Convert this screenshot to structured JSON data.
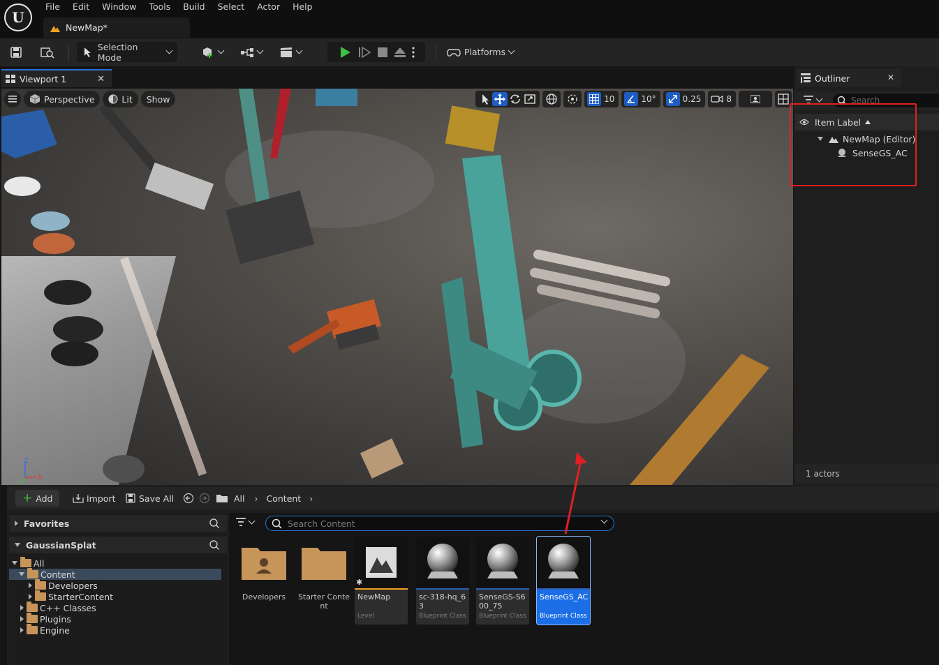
{
  "menu": [
    "File",
    "Edit",
    "Window",
    "Tools",
    "Build",
    "Select",
    "Actor",
    "Help"
  ],
  "document_tab": {
    "label": "NewMap*"
  },
  "toolbar": {
    "selection_mode": "Selection Mode",
    "platforms": "Platforms"
  },
  "viewport": {
    "tab_label": "Viewport 1",
    "perspective": "Perspective",
    "lit": "Lit",
    "show": "Show",
    "grid_snap": "10",
    "rotation_snap": "10°",
    "scale_snap": "0.25",
    "camera_speed": "8",
    "axis_z": "Z",
    "axis_x": "X"
  },
  "outliner": {
    "tab_label": "Outliner",
    "search_placeholder": "Search",
    "column_header": "Item Label",
    "tree": [
      {
        "label": "NewMap (Editor)",
        "icon": "level-icon"
      },
      {
        "label": "SenseGS_AC",
        "icon": "actor-icon"
      }
    ],
    "footer": "1 actors"
  },
  "content_browser": {
    "add": "Add",
    "import": "Import",
    "save_all": "Save All",
    "breadcrumb": [
      "All",
      "Content"
    ],
    "favorites": "Favorites",
    "project": "GaussianSplat",
    "search_placeholder": "Search Content",
    "folders": [
      {
        "label": "All",
        "level": 0,
        "expanded": true
      },
      {
        "label": "Content",
        "level": 1,
        "expanded": true,
        "selected": true
      },
      {
        "label": "Developers",
        "level": 2
      },
      {
        "label": "StarterContent",
        "level": 2
      },
      {
        "label": "C++ Classes",
        "level": 1
      },
      {
        "label": "Plugins",
        "level": 1
      },
      {
        "label": "Engine",
        "level": 1
      }
    ],
    "assets": [
      {
        "name": "Developers",
        "type": "",
        "kind": "folder"
      },
      {
        "name": "Starter Content",
        "type": "",
        "kind": "folder"
      },
      {
        "name": "NewMap",
        "type": "Level",
        "kind": "level"
      },
      {
        "name": "sc-318-hq_63",
        "type": "Blueprint Class",
        "kind": "blueprint"
      },
      {
        "name": "SenseGS-S600_75",
        "type": "Blueprint Class",
        "kind": "blueprint"
      },
      {
        "name": "SenseGS_AC",
        "type": "Blueprint Class",
        "kind": "blueprint",
        "selected": true
      }
    ]
  },
  "colors": {
    "accent": "#2b73d8",
    "annotation": "#e02020",
    "selection": "#1b6ee6",
    "folder": "#c7955a"
  }
}
